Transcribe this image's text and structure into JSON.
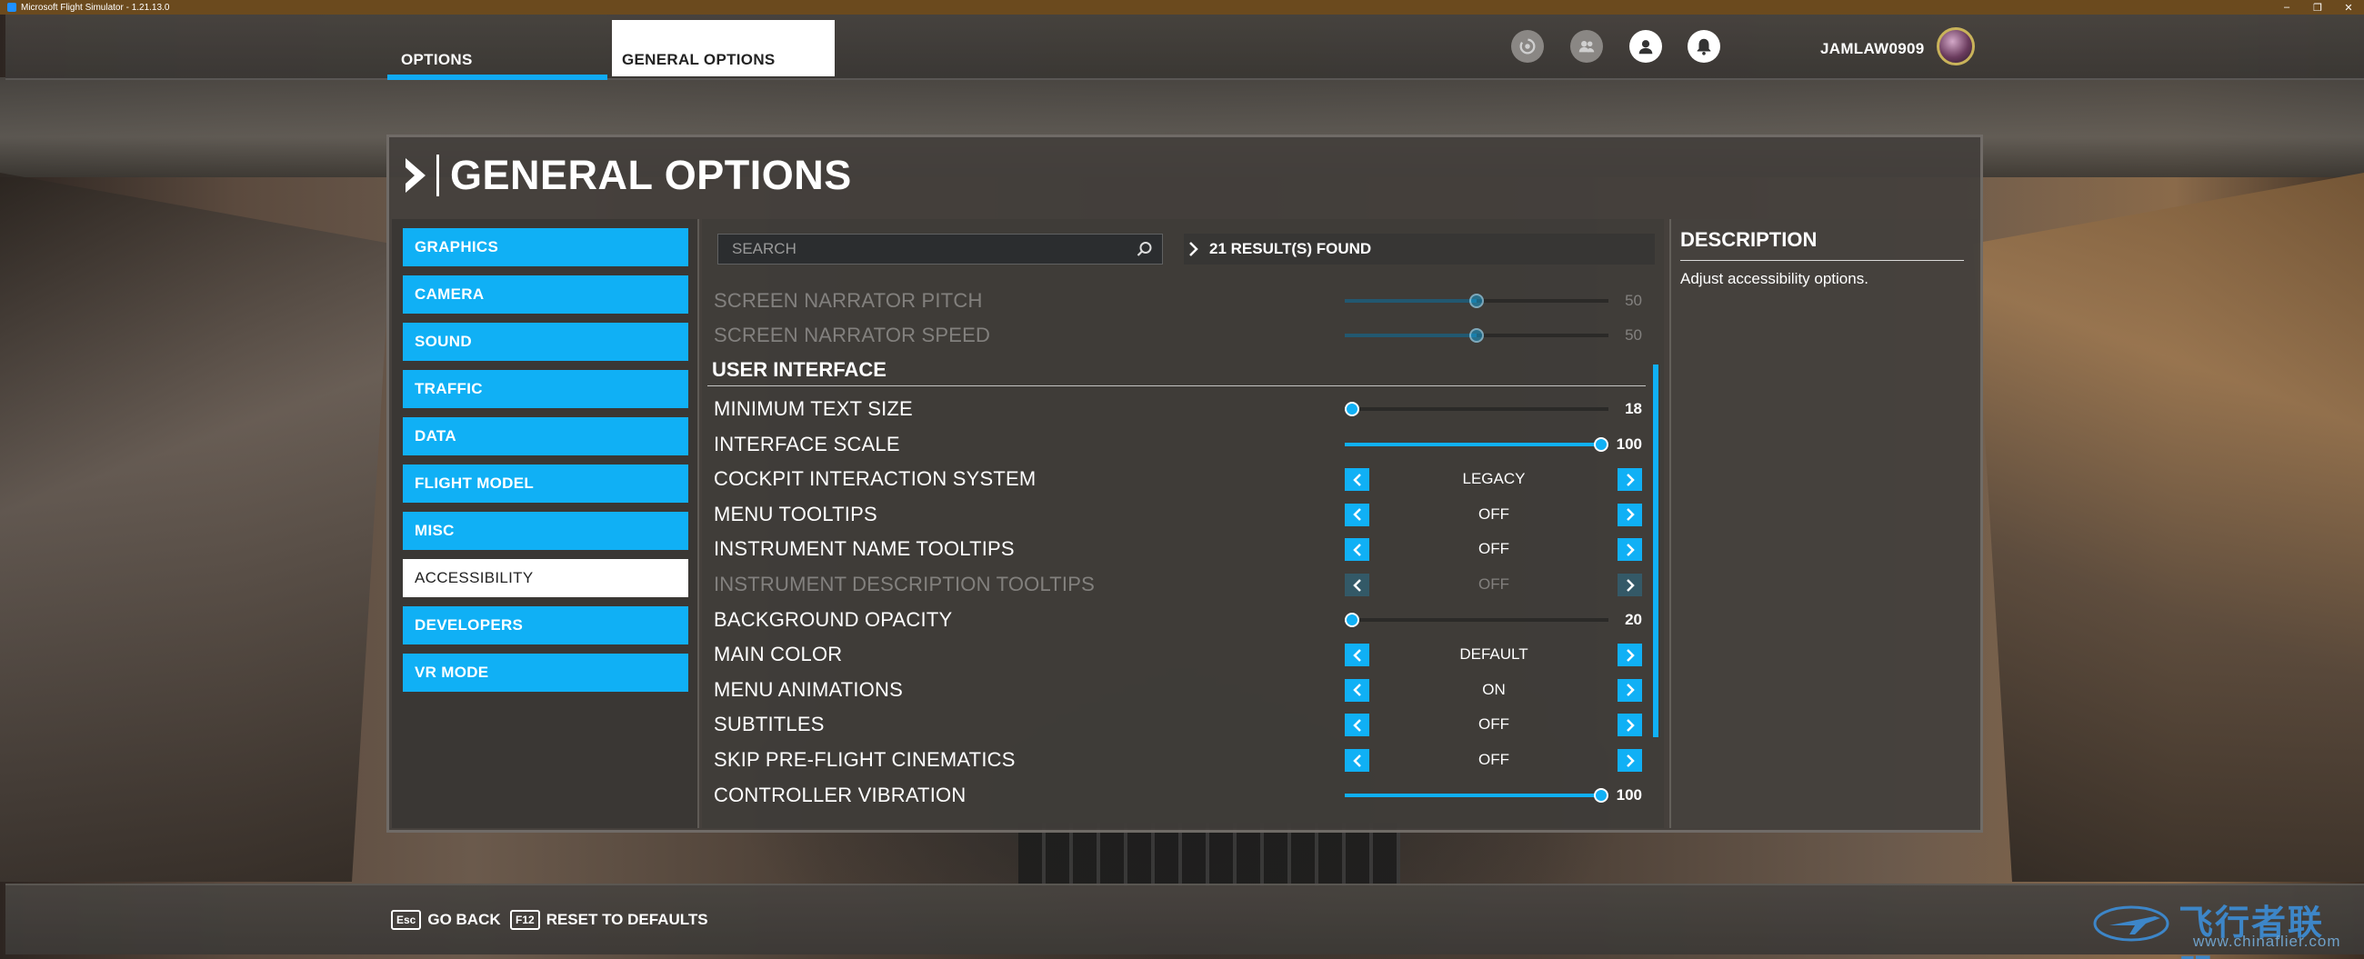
{
  "window": {
    "title": "Microsoft Flight Simulator - 1.21.13.0",
    "controls": [
      "–",
      "❐",
      "✕"
    ]
  },
  "topnav": {
    "tabs": [
      {
        "label": "OPTIONS",
        "active": true
      },
      {
        "label": "GENERAL OPTIONS",
        "active": false
      }
    ],
    "icons": [
      "activity-icon",
      "friends-icon",
      "profile-icon",
      "notifications-icon"
    ],
    "username": "JAMLAW0909"
  },
  "panel": {
    "title": "GENERAL OPTIONS",
    "categories": [
      {
        "label": "GRAPHICS",
        "active": false
      },
      {
        "label": "CAMERA",
        "active": false
      },
      {
        "label": "SOUND",
        "active": false
      },
      {
        "label": "TRAFFIC",
        "active": false
      },
      {
        "label": "DATA",
        "active": false
      },
      {
        "label": "FLIGHT MODEL",
        "active": false
      },
      {
        "label": "MISC",
        "active": false
      },
      {
        "label": "ACCESSIBILITY",
        "active": true
      },
      {
        "label": "DEVELOPERS",
        "active": false
      },
      {
        "label": "VR MODE",
        "active": false
      }
    ],
    "search": {
      "placeholder": "SEARCH",
      "value": ""
    },
    "results": "21 RESULT(S) FOUND",
    "pre_rows": [
      {
        "label": "SCREEN NARRATOR PITCH",
        "type": "slider",
        "value": "50",
        "fraction": 0.5
      },
      {
        "label": "SCREEN NARRATOR SPEED",
        "type": "slider",
        "value": "50",
        "fraction": 0.5
      }
    ],
    "section": "USER INTERFACE",
    "rows": [
      {
        "label": "MINIMUM TEXT SIZE",
        "type": "slider",
        "value": "18",
        "fraction": 0.0
      },
      {
        "label": "INTERFACE SCALE",
        "type": "slider",
        "value": "100",
        "fraction": 1.0
      },
      {
        "label": "COCKPIT INTERACTION SYSTEM",
        "type": "choice",
        "value": "LEGACY"
      },
      {
        "label": "MENU TOOLTIPS",
        "type": "choice",
        "value": "OFF"
      },
      {
        "label": "INSTRUMENT NAME TOOLTIPS",
        "type": "choice",
        "value": "OFF"
      },
      {
        "label": "INSTRUMENT DESCRIPTION TOOLTIPS",
        "type": "choice",
        "value": "OFF",
        "disabled": true
      },
      {
        "label": "BACKGROUND OPACITY",
        "type": "slider",
        "value": "20",
        "fraction": 0.0
      },
      {
        "label": "MAIN COLOR",
        "type": "choice",
        "value": "DEFAULT"
      },
      {
        "label": "MENU ANIMATIONS",
        "type": "choice",
        "value": "ON"
      },
      {
        "label": "SUBTITLES",
        "type": "choice",
        "value": "OFF"
      },
      {
        "label": "SKIP PRE-FLIGHT CINEMATICS",
        "type": "choice",
        "value": "OFF"
      },
      {
        "label": "CONTROLLER VIBRATION",
        "type": "slider",
        "value": "100",
        "fraction": 1.0
      }
    ],
    "description": {
      "title": "DESCRIPTION",
      "text": "Adjust accessibility options."
    }
  },
  "bottombar": {
    "hints": [
      {
        "key": "Esc",
        "label": "GO BACK"
      },
      {
        "key": "F12",
        "label": "RESET TO DEFAULTS"
      }
    ]
  },
  "watermark": {
    "name": "飞行者联盟",
    "url": "www.chinaflier.com"
  },
  "colors": {
    "accent": "#10b0f5",
    "panel": "#44403c",
    "titlebar": "#6b4a1e"
  }
}
